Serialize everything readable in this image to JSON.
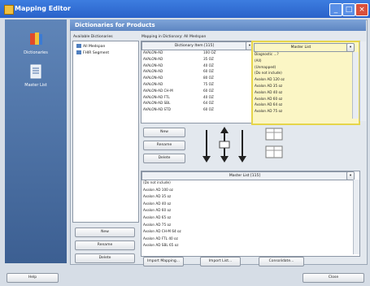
{
  "window": {
    "title": "Mapping Editor",
    "min": "_",
    "max": "□",
    "close": "×"
  },
  "nav": {
    "items": [
      {
        "label": "Dictionaries"
      },
      {
        "label": "Master List"
      }
    ]
  },
  "header": {
    "title": "Dictionaries for Products"
  },
  "dictionaries": {
    "label": "Available Dictionaries",
    "items": [
      {
        "label": "All Medspan"
      },
      {
        "label": "FHIR Segment"
      }
    ]
  },
  "mapping_label": "Mapping in Dictionary: All Medspan",
  "dictionary_grid": {
    "header": "Dictionary Item [115]",
    "rows": [
      {
        "name": "AVALON-AD",
        "qty": "100 OZ"
      },
      {
        "name": "AVALON-AD",
        "qty": "35 OZ"
      },
      {
        "name": "AVALON-AD",
        "qty": "40 OZ"
      },
      {
        "name": "AVALON-AD",
        "qty": "60 OZ"
      },
      {
        "name": "AVALON-AD",
        "qty": "80 OZ"
      },
      {
        "name": "AVALON-AD",
        "qty": "75 OZ"
      },
      {
        "name": "AVALON-AD CH-M",
        "qty": "60 OZ"
      },
      {
        "name": "AVALON-AD FTL",
        "qty": "40 OZ"
      },
      {
        "name": "AVALON-AD SBL",
        "qty": "64 OZ"
      },
      {
        "name": "AVALON-AD STD",
        "qty": "60 OZ"
      }
    ]
  },
  "master_grid": {
    "header": "Master List",
    "rows": [
      "Diagnostic ...?",
      "(All)",
      "(Unmapped)",
      "(Do not include)",
      "Avalon AD 120 oz",
      "Avalon AD 35 oz",
      "Avalon AD 40 oz",
      "Avalon AD 60 oz",
      "Avalon AD 64 oz",
      "Avalon AD 75 oz"
    ]
  },
  "mid_buttons": {
    "new": "New",
    "rename": "Rename",
    "delete": "Delete"
  },
  "master_list": {
    "header": "Master List [115]",
    "rows": [
      "(Do not include)",
      "Avalon AD 100 oz",
      "Avalon AD 35 oz",
      "Avalon AD 40 oz",
      "Avalon AD 60 oz",
      "Avalon AD 65 oz",
      "Avalon AD 75 oz",
      "Avalon AD CH-M 64 oz",
      "Avalon AD FTL 40 oz",
      "Avalon AD SBL 65 oz"
    ]
  },
  "left_buttons": {
    "new": "New",
    "rename": "Rename",
    "delete": "Delete"
  },
  "bottom_buttons": {
    "import_mapping": "Import Mapping...",
    "import_list": "Import List...",
    "consolidate": "Consolidate..."
  },
  "footer": {
    "help": "Help",
    "close": "Close"
  }
}
